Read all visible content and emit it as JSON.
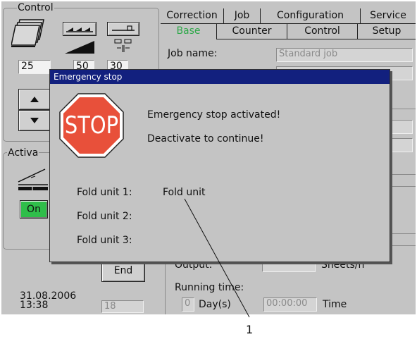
{
  "control_group": {
    "title": "Control",
    "value_1": "25",
    "value_2": "50",
    "value_3": "30"
  },
  "activation_group": {
    "title": "Activa",
    "on_button": "On"
  },
  "tabs_row1": [
    "Correction",
    "Job",
    "Configuration",
    "Service"
  ],
  "tabs_row2": [
    "Base",
    "Counter",
    "Control",
    "Setup"
  ],
  "active_tab": "Base",
  "job": {
    "label": "Job name:",
    "value": "Standard job"
  },
  "output": {
    "label": "Output:",
    "unit": "Sheets/h"
  },
  "running_time": {
    "label": "Running time:",
    "days_value": "0",
    "days_label": "Day(s)",
    "time_value": "00:00:00",
    "time_label": "Time"
  },
  "end_button": "End",
  "status": {
    "date": "31.08.2006",
    "time": "13:38",
    "counter": "18"
  },
  "dialog": {
    "title": "Emergency stop",
    "stop_sign_text": "STOP",
    "message_1": "Emergency stop activated!",
    "message_2": "Deactivate to continue!",
    "fold_units": [
      {
        "label": "Fold unit 1:",
        "value": "Fold unit"
      },
      {
        "label": "Fold unit 2:",
        "value": ""
      },
      {
        "label": "Fold unit 3:",
        "value": ""
      }
    ]
  },
  "callout_number": "1",
  "colors": {
    "screen_bg": "#c4c4c4",
    "dialog_title_bg": "#12207e",
    "stop_red": "#e8503a",
    "on_button_green": "#2fbe4a",
    "active_tab_text": "#2fa84a"
  }
}
